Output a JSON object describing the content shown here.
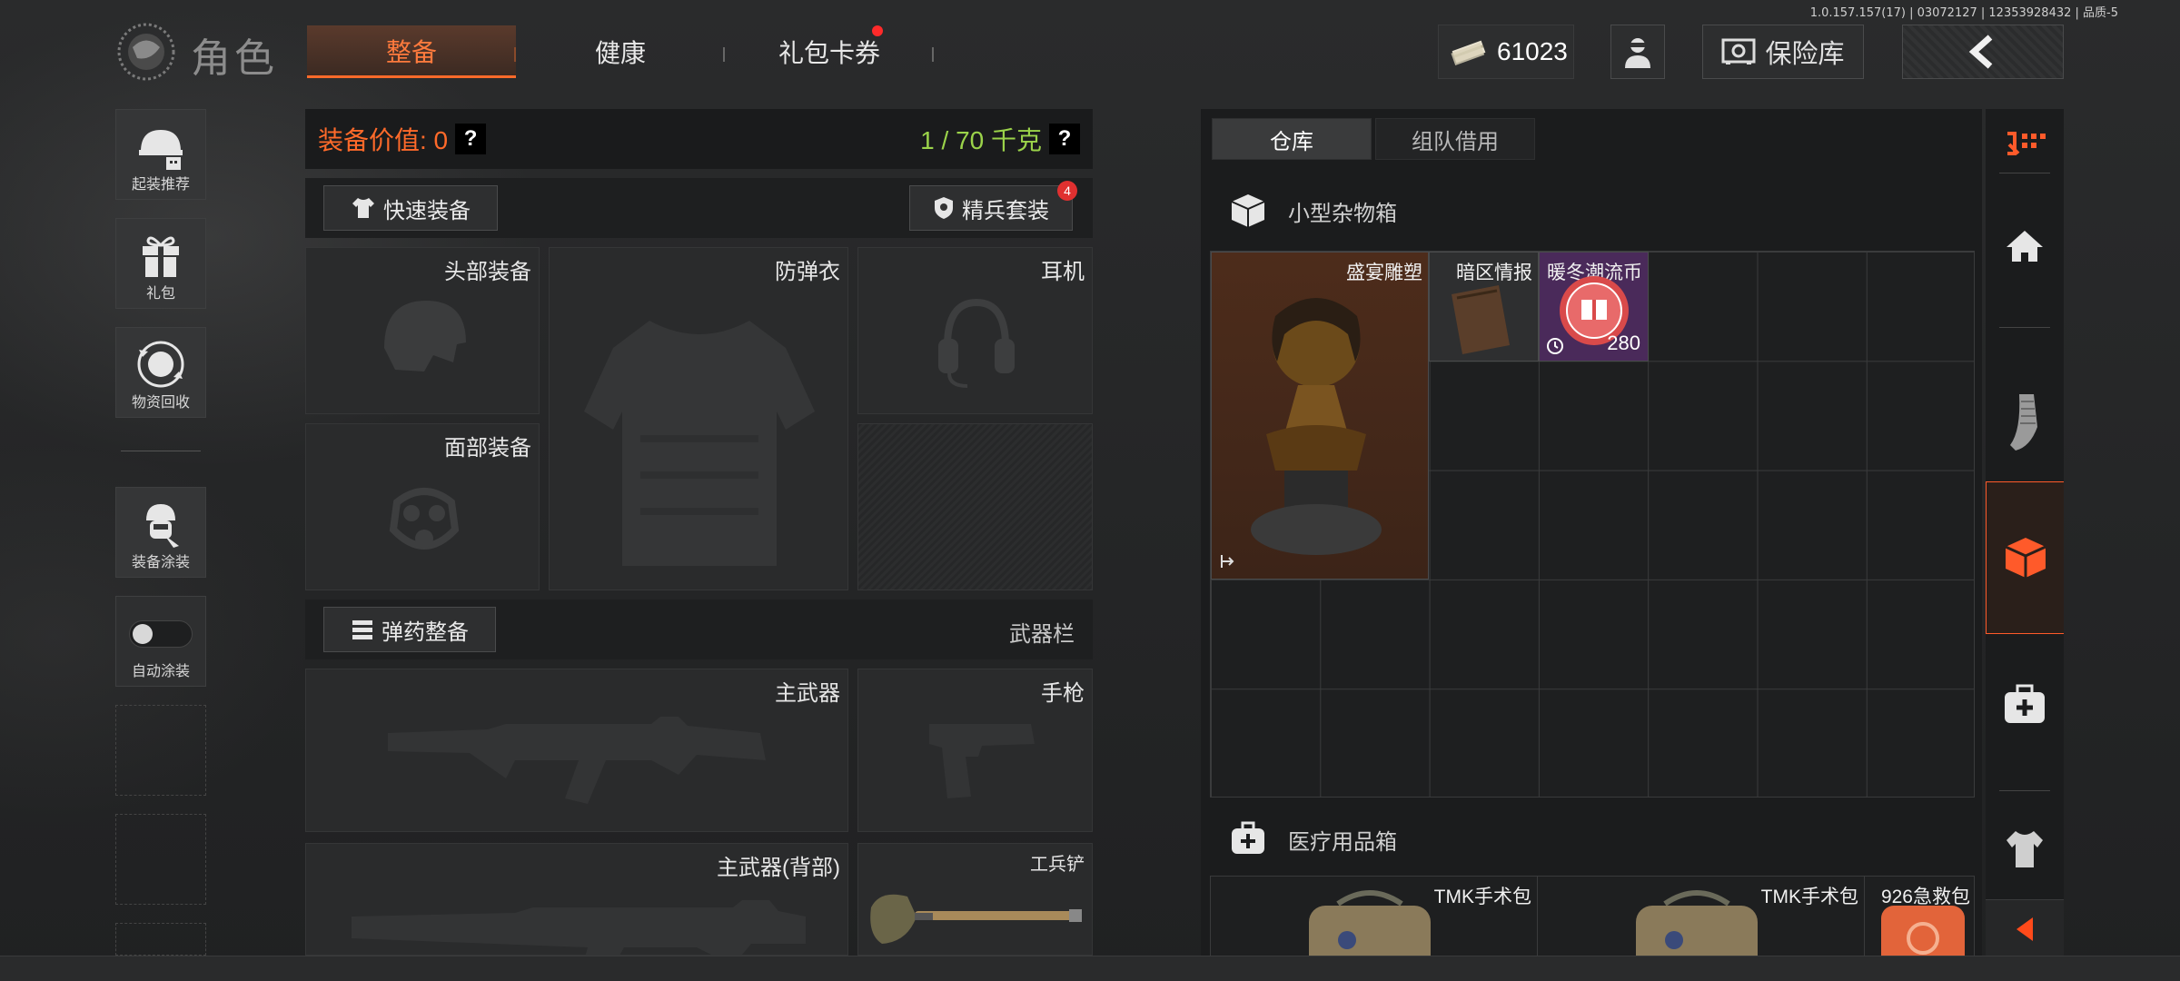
{
  "version_text": "1.0.157.157(17) | 03072127 | 12353928432 | 品质-5",
  "header": {
    "title": "角色",
    "tabs": [
      {
        "label": "整备",
        "active": true
      },
      {
        "label": "健康",
        "active": false
      },
      {
        "label": "礼包卡券",
        "active": false,
        "notify": true
      }
    ],
    "currency_amount": "61023",
    "safe_label": "保险库"
  },
  "sidebar": {
    "items": [
      {
        "label": "起装推荐",
        "icon": "helmet-recommend-icon"
      },
      {
        "label": "礼包",
        "icon": "gift-icon"
      },
      {
        "label": "物资回收",
        "icon": "recycle-icon"
      },
      {
        "label": "装备涂装",
        "icon": "soldier-paint-icon"
      },
      {
        "label": "自动涂装",
        "icon": "toggle-icon",
        "toggle_on": false
      }
    ]
  },
  "equipment": {
    "value_label": "装备价值: 0",
    "weight_label": "1 / 70 千克",
    "quick_equip_label": "快速装备",
    "elite_set_label": "精兵套装",
    "elite_set_badge": "4",
    "slots": {
      "head": "头部装备",
      "armor": "防弹衣",
      "headset": "耳机",
      "face": "面部装备"
    },
    "ammo_label": "弹药整备",
    "weapon_bar_label": "武器栏",
    "weapon_slots": {
      "primary": "主武器",
      "pistol": "手枪",
      "primary_back": "主武器(背部)",
      "shovel": "工兵铲"
    }
  },
  "storage": {
    "tabs": [
      {
        "label": "仓库",
        "active": true
      },
      {
        "label": "组队借用",
        "active": false
      }
    ],
    "sundries_box_label": "小型杂物箱",
    "medical_box_label": "医疗用品箱",
    "items": [
      {
        "label": "盛宴雕塑",
        "color": "#4a2a1a"
      },
      {
        "label": "暗区情报",
        "color": "#2e2f30"
      },
      {
        "label": "暖冬潮流币",
        "count": "280",
        "color": "#4a2a5a"
      }
    ],
    "medical_items": [
      {
        "label": "TMK手术包"
      },
      {
        "label": "TMK手术包"
      },
      {
        "label": "926急救包"
      }
    ]
  },
  "colors": {
    "accent": "#ff6a2a",
    "weight_green": "#9bd34a"
  }
}
